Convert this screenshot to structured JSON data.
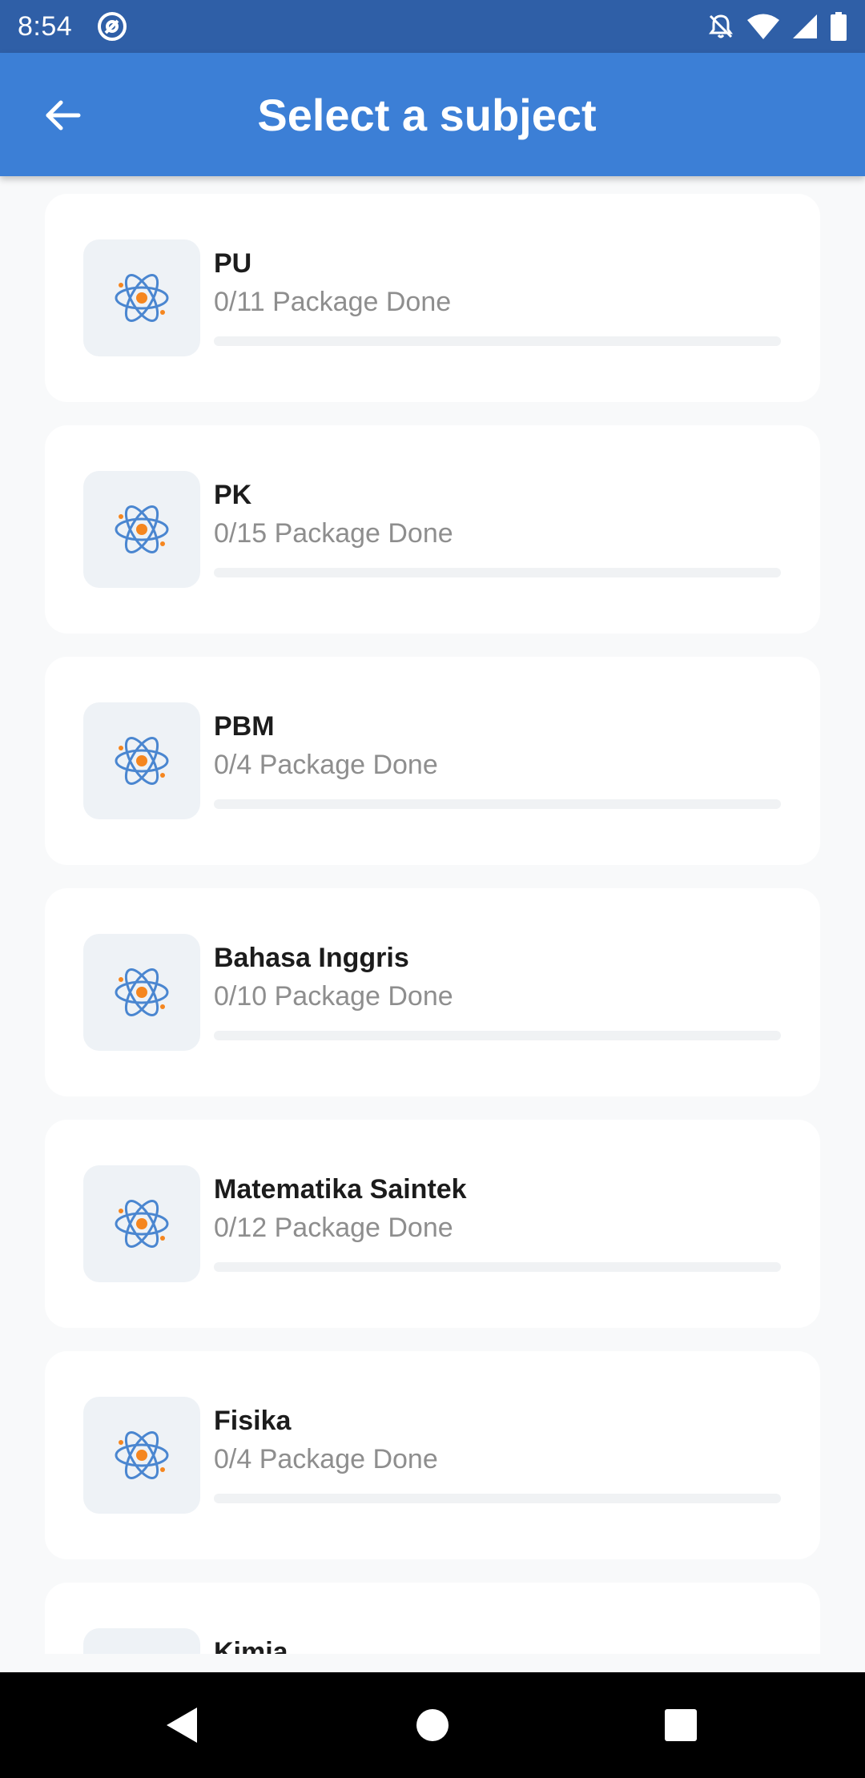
{
  "status_bar": {
    "time": "8:54",
    "app_icon": "at-sign-circle-icon",
    "icons": [
      "bell-off-icon",
      "wifi-icon",
      "cell-signal-icon",
      "battery-icon"
    ]
  },
  "app_bar": {
    "title": "Select a subject",
    "back_icon": "arrow-back-icon",
    "color": "#3c7fd6"
  },
  "subjects": [
    {
      "name": "PU",
      "progress_text": "0/11 Package Done",
      "progress": 0,
      "icon": "atom-icon"
    },
    {
      "name": "PK",
      "progress_text": "0/15 Package Done",
      "progress": 0,
      "icon": "atom-icon"
    },
    {
      "name": "PBM",
      "progress_text": "0/4 Package Done",
      "progress": 0,
      "icon": "atom-icon"
    },
    {
      "name": "Bahasa Inggris",
      "progress_text": "0/10 Package Done",
      "progress": 0,
      "icon": "atom-icon"
    },
    {
      "name": "Matematika Saintek",
      "progress_text": "0/12 Package Done",
      "progress": 0,
      "icon": "atom-icon"
    },
    {
      "name": "Fisika",
      "progress_text": "0/4 Package Done",
      "progress": 0,
      "icon": "atom-icon"
    },
    {
      "name": "Kimia",
      "progress_text": "",
      "progress": 0,
      "icon": "atom-icon"
    }
  ],
  "nav_bar": {
    "buttons": [
      "back-triangle-icon",
      "home-circle-icon",
      "recents-square-icon"
    ]
  }
}
